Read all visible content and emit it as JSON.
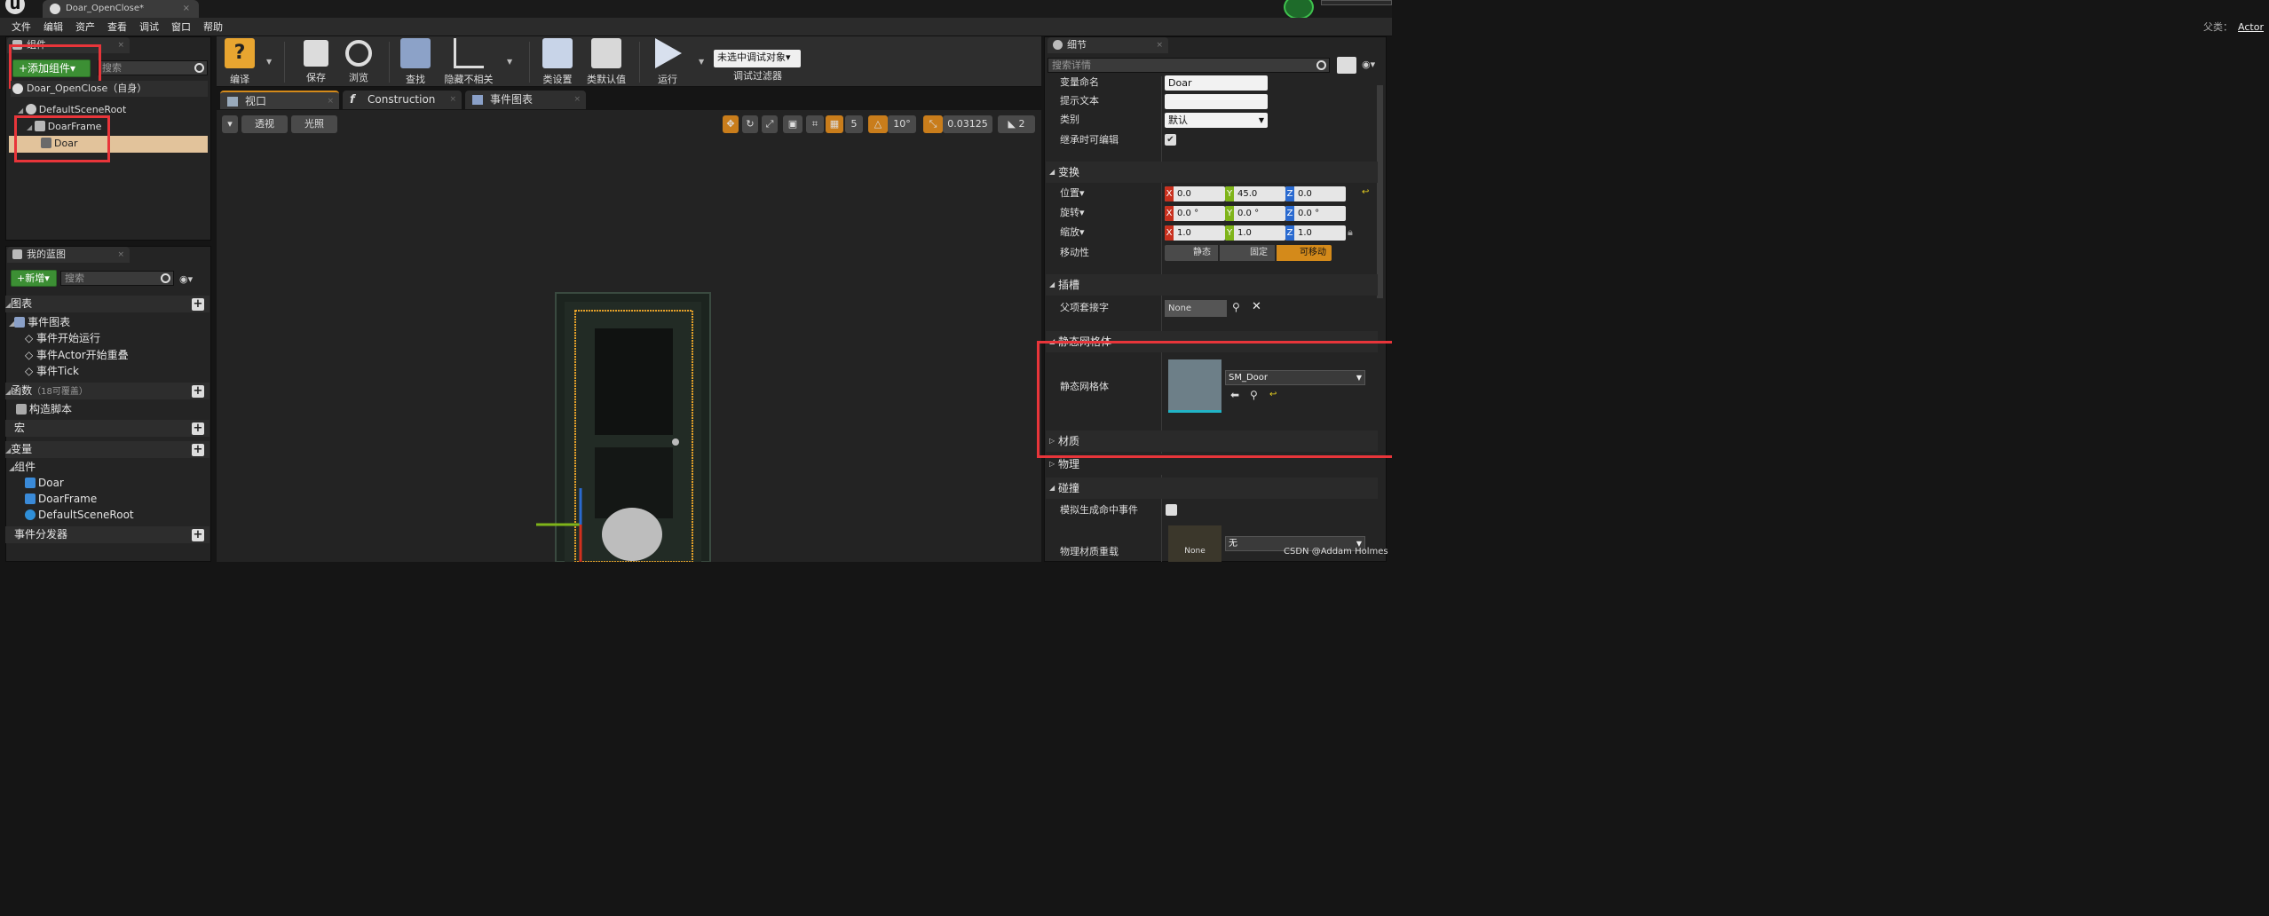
{
  "window": {
    "tab_title": "Doar_OpenClose*",
    "parent_label": "父类：",
    "parent_value": "Actor"
  },
  "menu": [
    "文件",
    "编辑",
    "资产",
    "查看",
    "调试",
    "窗口",
    "帮助"
  ],
  "components_panel": {
    "tab": "组件",
    "add_button": "+添加组件▾",
    "search_placeholder": "搜索",
    "self_label": "Doar_OpenClose（自身）",
    "tree": [
      "DefaultSceneRoot",
      "DoarFrame",
      "Doar"
    ]
  },
  "my_blueprint": {
    "tab": "我的蓝图",
    "new_button": "+新增▾",
    "search_placeholder": "搜索",
    "sections": {
      "graphs": "图表",
      "event_graph": "事件图表",
      "events": [
        "事件开始运行",
        "事件Actor开始重叠",
        "事件Tick"
      ],
      "functions": "函数",
      "functions_override": "（18可覆盖）",
      "construction": "构造脚本",
      "macros": "宏",
      "variables": "变量",
      "components_group": "组件",
      "components": [
        "Doar",
        "DoarFrame",
        "DefaultSceneRoot"
      ],
      "dispatchers": "事件分发器"
    }
  },
  "toolbar": {
    "compile": "编译",
    "save": "保存",
    "browse": "浏览",
    "find": "查找",
    "hide_unrelated": "隐藏不相关",
    "class_settings": "类设置",
    "class_defaults": "类默认值",
    "play": "运行",
    "debug_selector": "未选中调试对象▾",
    "debug_filter": "调试过滤器"
  },
  "editor_tabs": [
    "视口",
    "Construction Script",
    "事件图表"
  ],
  "viewport": {
    "perspective": "透视",
    "lit": "光照",
    "grid_snap": "5",
    "rot_snap": "10°",
    "scale_snap": "0.03125",
    "camera_speed": "2"
  },
  "details": {
    "tab": "细节",
    "search_placeholder": "搜索详情",
    "variable_name_label": "变量命名",
    "variable_name": "Doar",
    "tooltip_label": "提示文本",
    "category_label": "类别",
    "category_value": "默认",
    "editable_label": "继承时可编辑",
    "transform_header": "变换",
    "location_label": "位置▾",
    "location": [
      "0.0",
      "45.0",
      "0.0"
    ],
    "rotation_label": "旋转▾",
    "rotation": [
      "0.0 °",
      "0.0 °",
      "0.0 °"
    ],
    "scale_label": "缩放▾",
    "scale": [
      "1.0",
      "1.0",
      "1.0"
    ],
    "mobility_label": "移动性",
    "mobility_options": [
      "静态",
      "固定",
      "可移动"
    ],
    "sockets_header": "插槽",
    "parent_socket_label": "父项套接字",
    "parent_socket_value": "None",
    "static_mesh_header": "静态网格体",
    "static_mesh_label": "静态网格体",
    "static_mesh_value": "SM_Door",
    "materials_header": "材质",
    "physics_header": "物理",
    "collision_header": "碰撞",
    "sim_hit_label": "模拟生成命中事件",
    "phys_material_label": "物理材质重载",
    "phys_material_thumb": "None",
    "phys_material_value": "无"
  },
  "watermark": "CSDN @Addam Holmes",
  "colors": {
    "accent_green": "#3c8f34",
    "highlight_red": "#e8353a",
    "selection": "#e2c39b",
    "axis_x": "#c8301e",
    "axis_y": "#7fb41a",
    "axis_z": "#2a6ad0",
    "movable_orange": "#d48a1a"
  }
}
